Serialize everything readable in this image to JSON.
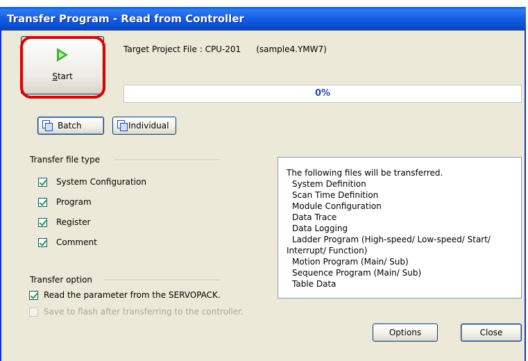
{
  "window": {
    "title": "Transfer Program - Read from Controller"
  },
  "start_button": {
    "label": "Start",
    "icon": "play-icon"
  },
  "target": {
    "label": "Target Project File : CPU-201",
    "filename": "(sample4.YMW7)"
  },
  "progress": {
    "text": "0%",
    "value": 0
  },
  "mode_buttons": {
    "batch": "Batch",
    "individual": "Individual"
  },
  "transfer_file_type": {
    "label": "Transfer file type",
    "items": [
      {
        "label": "System Configuration",
        "checked": true
      },
      {
        "label": "Program",
        "checked": true
      },
      {
        "label": "Register",
        "checked": true
      },
      {
        "label": "Comment",
        "checked": true
      }
    ]
  },
  "transfer_option": {
    "label": "Transfer option",
    "items": [
      {
        "label": "Read the parameter from the SERVOPACK.",
        "checked": true,
        "enabled": true
      },
      {
        "label": "Save to flash after transferring to the controller.",
        "checked": false,
        "enabled": false
      }
    ]
  },
  "file_list": {
    "header": "The following files will be transferred.",
    "items": [
      "System Definition",
      "Scan Time Definition",
      "Module Configuration",
      "Data Trace",
      "Data Logging",
      "Ladder Program (High-speed/ Low-speed/ Start/",
      "Interrupt/ Function)",
      "Motion Program (Main/ Sub)",
      "Sequence Program (Main/ Sub)",
      "Table Data"
    ]
  },
  "buttons": {
    "options": "Options",
    "close": "Close"
  },
  "colors": {
    "title_bar": "#0a4fd4",
    "highlight": "#e00000",
    "progress_text": "#2a4ab8"
  }
}
